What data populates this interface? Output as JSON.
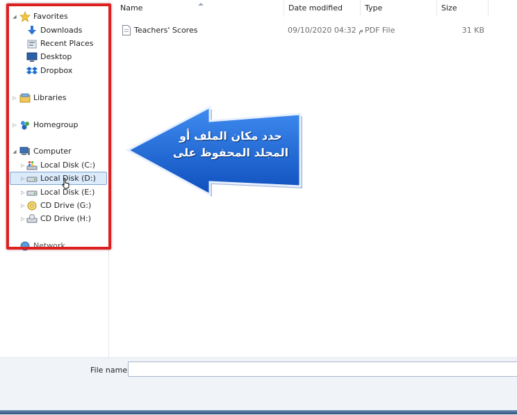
{
  "nav": {
    "favorites": "Favorites",
    "downloads": "Downloads",
    "recent_places": "Recent Places",
    "desktop": "Desktop",
    "dropbox": "Dropbox",
    "libraries": "Libraries",
    "homegroup": "Homegroup",
    "computer": "Computer",
    "drives": [
      {
        "label": "Local Disk (C:)",
        "icon": "system-drive-icon"
      },
      {
        "label": "Local Disk (D:)",
        "icon": "hard-drive-icon"
      },
      {
        "label": "Local Disk (E:)",
        "icon": "hard-drive-icon"
      },
      {
        "label": "CD Drive (G:)",
        "icon": "cd-drive-icon"
      },
      {
        "label": "CD Drive (H:)",
        "icon": "cd-drive-icon"
      }
    ],
    "network": "Network",
    "selected": "Local Disk (D:)"
  },
  "columns": {
    "name": "Name",
    "date_modified": "Date modified",
    "type": "Type",
    "size": "Size"
  },
  "files": [
    {
      "name": "Teachers' Scores",
      "date": "09/10/2020 04:32 م",
      "type": "PDF File",
      "size": "31 KB"
    }
  ],
  "file_name": {
    "label": "File name:",
    "value": ""
  },
  "callout": {
    "line1": "حدد مكان الملف أو",
    "line2": "المجلد المحفوظ على",
    "color": "#1a63d6"
  },
  "highlight_color": "#dd1f1f"
}
